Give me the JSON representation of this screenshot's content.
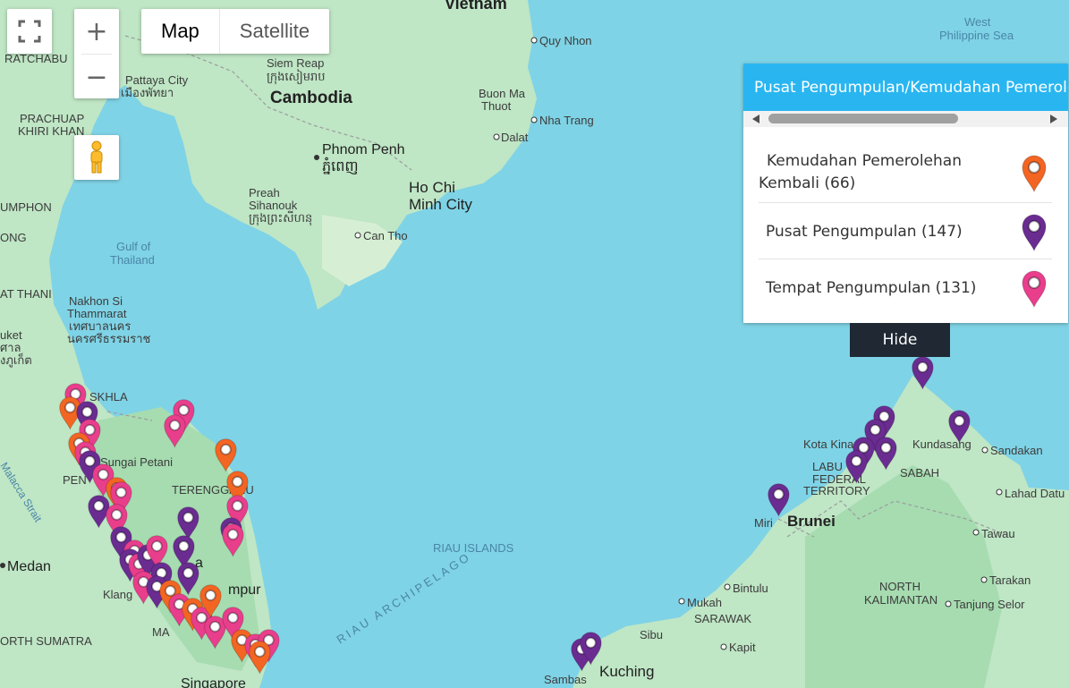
{
  "controls": {
    "map_type_options": [
      "Map",
      "Satellite"
    ],
    "zoom_in": "+",
    "zoom_out": "−"
  },
  "legend": {
    "title": "Pusat Pengumpulan/Kemudahan Pemerolehan Kembali",
    "items": [
      {
        "label": "Kemudahan Pemerolehan Kembali (66)",
        "color": "#f26522"
      },
      {
        "label": "Pusat Pengumpulan (147)",
        "color": "#6a2c91"
      },
      {
        "label": "Tempat Pengumpulan (131)",
        "color": "#e83e8c"
      }
    ],
    "hide_label": "Hide"
  },
  "map_labels": {
    "vietnam": "Vietnam",
    "west_ph_sea_1": "West",
    "west_ph_sea_2": "Philippine Sea",
    "ratchaburi": "RATCHABU",
    "siem_reap": "Siem Reap",
    "siem_reap_kh": "ក្រុងសៀមរាប",
    "cambodia": "Cambodia",
    "pattaya": "Pattaya City",
    "pattaya_th": "เมืองพัทยา",
    "quy_nhon": "Quy Nhon",
    "buon_ma_1": "Buon Ma",
    "buon_ma_2": "Thuot",
    "nha_trang": "Nha Trang",
    "prachuap_1": "PRACHUAP",
    "prachuap_2": "KHIRI KHAN",
    "phnom_penh": "Phnom Penh",
    "phnom_penh_kh": "ភ្នំពេញ",
    "dalat": "Dalat",
    "chumphon": "UMPHON",
    "preah_1": "Preah",
    "preah_2": "Sihanouk",
    "preah_kh": "ក្រុងព្រះសីហនុ",
    "hcmc_1": "Ho Chi",
    "hcmc_2": "Minh City",
    "ranong": "ONG",
    "can_tho": "Can Tho",
    "gulf_1": "Gulf of",
    "gulf_2": "Thailand",
    "surat_thani": "AT THANI",
    "nakhon_1": "Nakhon Si",
    "nakhon_2": "Thammarat",
    "nakhon_th1": "เทศบาลนคร",
    "nakhon_th2": "นครศรีธรรมราช",
    "phuket_1": "uket",
    "phuket_th1": "ศาล",
    "phuket_th2": "งภูเก็ต",
    "songkhla": "SKHLA",
    "sungai_petani": "Sungai Petani",
    "penang": "PEN",
    "malacca_strait": "Malacca Strait",
    "terengganu": "TERENGGANU",
    "medan": "Medan",
    "riau_islands": "RIAU ISLANDS",
    "riau_archipelago": "RIAU ARCHIPELAGO",
    "kuala_lumpur": "mpur",
    "kl_a": "a",
    "klang": "Klang",
    "malacca": "MA",
    "north_sumatra": "ORTH SUMATRA",
    "singapore": "Singapore",
    "kota_kinabalu": "Kota Kina",
    "labuan_1": "LABU",
    "labuan_2": "FEDERAL",
    "labuan_3": "TERRITORY",
    "kundasang": "Kundasang",
    "sandakan": "Sandakan",
    "sabah": "SABAH",
    "lahad_datu": "Lahad Datu",
    "miri": "Miri",
    "brunei": "Brunei",
    "tawau": "Tawau",
    "bintulu": "Bintulu",
    "north_kal_1": "NORTH",
    "north_kal_2": "KALIMANTAN",
    "mukah": "Mukah",
    "sarawak": "SARAWAK",
    "tarakan": "Tarakan",
    "tanjung_selor": "Tanjung Selor",
    "sibu": "Sibu",
    "kapit": "Kapit",
    "kuching": "Kuching",
    "sambas": "Sambas"
  }
}
